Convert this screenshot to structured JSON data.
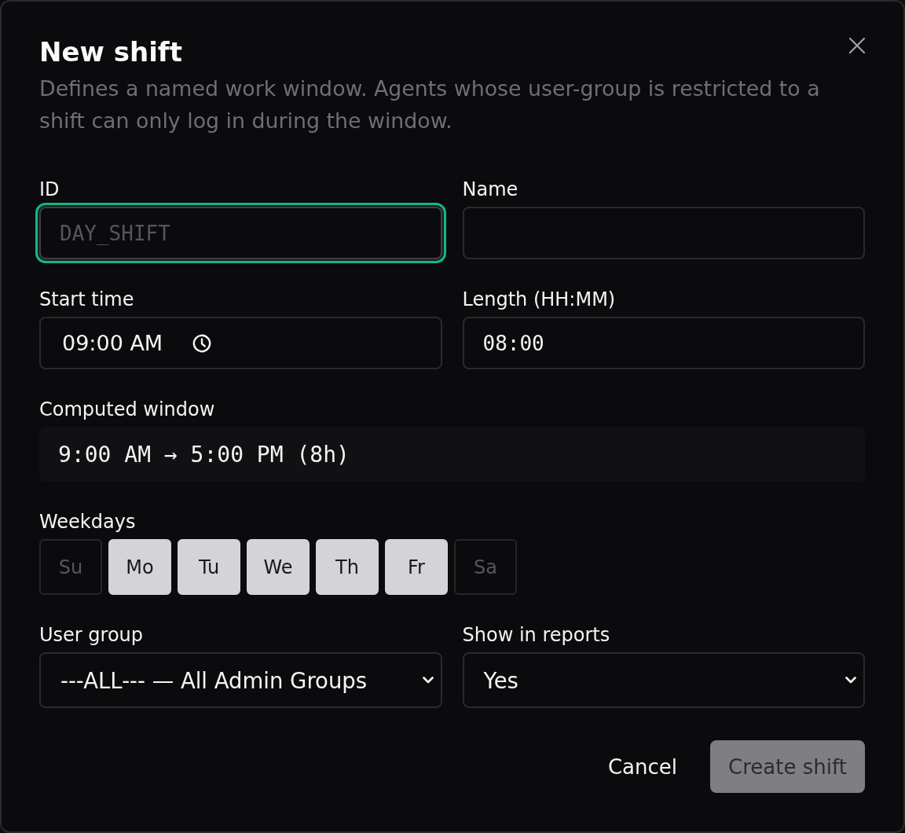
{
  "dialog": {
    "title": "New shift",
    "description": "Defines a named work window. Agents whose user-group is restricted to a shift can only log in during the window."
  },
  "id_field": {
    "label": "ID",
    "placeholder": "DAY_SHIFT",
    "focused": true
  },
  "name_field": {
    "label": "Name",
    "focused": false
  },
  "start_time_field": {
    "label": "Start time",
    "value": "09:00 AM"
  },
  "length_field": {
    "label": "Length (HH:MM)",
    "value": "08:00"
  },
  "computed_window": {
    "label": "Computed window",
    "value": "9:00 AM → 5:00 PM (8h)"
  },
  "weekdays": {
    "label": "Weekdays",
    "days": [
      {
        "label": "Su",
        "selected": false
      },
      {
        "label": "Mo",
        "selected": true
      },
      {
        "label": "Tu",
        "selected": true
      },
      {
        "label": "We",
        "selected": true
      },
      {
        "label": "Th",
        "selected": true
      },
      {
        "label": "Fr",
        "selected": true
      },
      {
        "label": "Sa",
        "selected": false
      }
    ]
  },
  "user_group_select": {
    "label": "User group",
    "value": "---ALL--- — All Admin Groups"
  },
  "show_in_reports_select": {
    "label": "Show in reports",
    "value": "Yes"
  },
  "buttons": [
    {
      "label": "Cancel",
      "kind": "text",
      "disabled": false
    },
    {
      "label": "Create shift",
      "kind": "filled",
      "disabled": true
    }
  ]
}
